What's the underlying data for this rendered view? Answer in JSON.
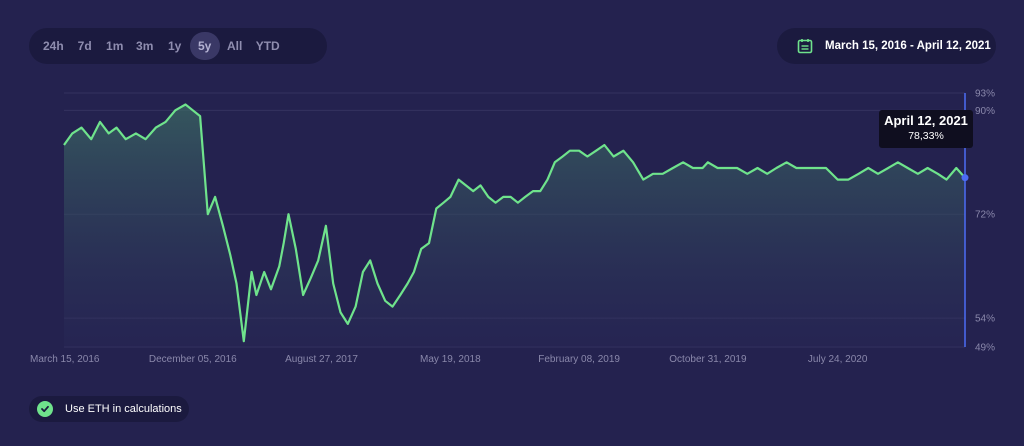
{
  "ranges": [
    {
      "label": "24h",
      "active": false
    },
    {
      "label": "7d",
      "active": false
    },
    {
      "label": "1m",
      "active": false
    },
    {
      "label": "3m",
      "active": false
    },
    {
      "label": "1y",
      "active": false
    },
    {
      "label": "5y",
      "active": true
    },
    {
      "label": "All",
      "active": false
    },
    {
      "label": "YTD",
      "active": false
    }
  ],
  "date_range": {
    "label": "March 15, 2016 - April 12, 2021",
    "icon": "calendar-icon"
  },
  "toggle": {
    "label": "Use ETH in calculations",
    "checked": true,
    "icon": "check-icon"
  },
  "tooltip": {
    "date": "April 12, 2021",
    "value": "78,33%"
  },
  "colors": {
    "line": "#6fe38c",
    "accent": "#4c6cf5",
    "background": "#24224f",
    "panel": "#1b1a3f"
  },
  "chart_data": {
    "type": "area",
    "title": "",
    "xlabel": "",
    "ylabel": "",
    "ylim": [
      49,
      93
    ],
    "y_ticks": [
      "93%",
      "90%",
      "72%",
      "54%",
      "49%"
    ],
    "y_tick_values": [
      93,
      90,
      72,
      54,
      49
    ],
    "x_ticks": [
      "March 15, 2016",
      "December 05, 2016",
      "August 27, 2017",
      "May 19, 2018",
      "February 08, 2019",
      "October 31, 2019",
      "July 24, 2020"
    ],
    "grid": true,
    "series": [
      {
        "x": [
          "2016-03-15",
          "2016-04-01",
          "2016-04-20",
          "2016-05-10",
          "2016-05-28",
          "2016-06-15",
          "2016-07-01",
          "2016-07-20",
          "2016-08-10",
          "2016-08-30",
          "2016-09-20",
          "2016-10-10",
          "2016-10-30",
          "2016-11-20",
          "2016-12-05",
          "2016-12-20",
          "2017-01-05",
          "2017-01-20",
          "2017-02-05",
          "2017-02-20",
          "2017-03-05",
          "2017-03-20",
          "2017-04-05",
          "2017-04-15",
          "2017-05-01",
          "2017-05-15",
          "2017-06-01",
          "2017-06-10",
          "2017-06-20",
          "2017-07-05",
          "2017-07-20",
          "2017-08-05",
          "2017-08-20",
          "2017-09-05",
          "2017-09-20",
          "2017-10-05",
          "2017-10-20",
          "2017-11-05",
          "2017-11-20",
          "2017-12-05",
          "2017-12-20",
          "2018-01-05",
          "2018-01-20",
          "2018-02-05",
          "2018-02-20",
          "2018-03-05",
          "2018-03-20",
          "2018-04-05",
          "2018-04-20",
          "2018-05-05",
          "2018-05-19",
          "2018-06-05",
          "2018-06-20",
          "2018-07-05",
          "2018-07-20",
          "2018-08-05",
          "2018-08-20",
          "2018-09-05",
          "2018-09-20",
          "2018-10-05",
          "2018-10-20",
          "2018-11-05",
          "2018-11-20",
          "2018-12-05",
          "2018-12-20",
          "2019-01-05",
          "2019-01-20",
          "2019-02-08",
          "2019-02-25",
          "2019-03-15",
          "2019-04-01",
          "2019-04-20",
          "2019-05-10",
          "2019-05-30",
          "2019-06-20",
          "2019-07-10",
          "2019-07-30",
          "2019-08-20",
          "2019-09-10",
          "2019-09-30",
          "2019-10-20",
          "2019-10-31",
          "2019-11-20",
          "2019-12-10",
          "2019-12-30",
          "2020-01-20",
          "2020-02-10",
          "2020-03-01",
          "2020-03-20",
          "2020-04-10",
          "2020-04-30",
          "2020-05-20",
          "2020-06-10",
          "2020-06-30",
          "2020-07-24",
          "2020-08-15",
          "2020-09-05",
          "2020-09-25",
          "2020-10-15",
          "2020-11-05",
          "2020-11-25",
          "2020-12-15",
          "2021-01-05",
          "2021-01-25",
          "2021-02-15",
          "2021-03-05",
          "2021-03-25",
          "2021-04-12"
        ],
        "values": [
          84,
          86,
          87,
          85,
          88,
          86,
          87,
          85,
          86,
          85,
          87,
          88,
          90,
          91,
          90,
          89,
          72,
          75,
          70,
          65,
          60,
          50,
          62,
          58,
          62,
          59,
          63,
          67,
          72,
          66,
          58,
          61,
          64,
          70,
          60,
          55,
          53,
          56,
          62,
          64,
          60,
          57,
          56,
          58,
          60,
          62,
          66,
          67,
          73,
          74,
          75,
          78,
          77,
          76,
          77,
          75,
          74,
          75,
          75,
          74,
          75,
          76,
          76,
          78,
          81,
          82,
          83,
          83,
          82,
          83,
          84,
          82,
          83,
          81,
          78,
          79,
          79,
          80,
          81,
          80,
          80,
          81,
          80,
          80,
          80,
          79,
          80,
          79,
          80,
          81,
          80,
          80,
          80,
          80,
          78,
          78,
          79,
          80,
          79,
          80,
          81,
          80,
          79,
          80,
          79,
          78,
          80,
          78.33
        ]
      }
    ]
  }
}
